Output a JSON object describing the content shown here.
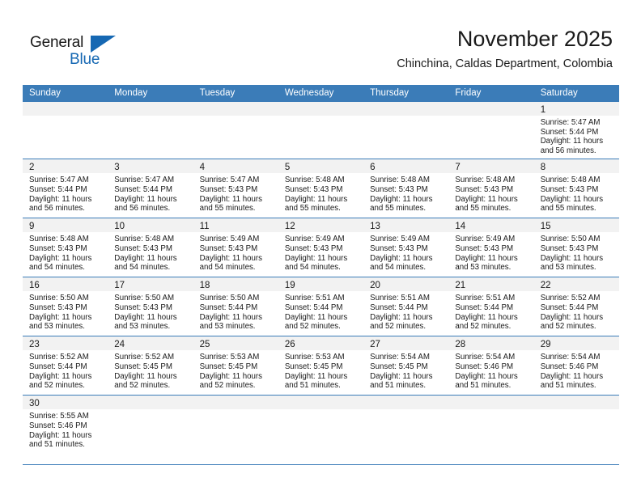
{
  "brand": {
    "name_part1": "General",
    "name_part2": "Blue",
    "accent_color": "#1668b3"
  },
  "header": {
    "title": "November 2025",
    "subtitle": "Chinchina, Caldas Department, Colombia"
  },
  "calendar": {
    "header_color": "#3b7cb8",
    "daynum_band_color": "#f2f2f2",
    "day_headers": [
      "Sunday",
      "Monday",
      "Tuesday",
      "Wednesday",
      "Thursday",
      "Friday",
      "Saturday"
    ],
    "labels": {
      "sunrise_prefix": "Sunrise:",
      "sunset_prefix": "Sunset:",
      "daylight_prefix": "Daylight:"
    },
    "weeks": [
      [
        {
          "empty": true
        },
        {
          "empty": true
        },
        {
          "empty": true
        },
        {
          "empty": true
        },
        {
          "empty": true
        },
        {
          "empty": true
        },
        {
          "day": "1",
          "sunrise": "Sunrise: 5:47 AM",
          "sunset": "Sunset: 5:44 PM",
          "daylight_line1": "Daylight: 11 hours",
          "daylight_line2": "and 56 minutes."
        }
      ],
      [
        {
          "day": "2",
          "sunrise": "Sunrise: 5:47 AM",
          "sunset": "Sunset: 5:44 PM",
          "daylight_line1": "Daylight: 11 hours",
          "daylight_line2": "and 56 minutes."
        },
        {
          "day": "3",
          "sunrise": "Sunrise: 5:47 AM",
          "sunset": "Sunset: 5:44 PM",
          "daylight_line1": "Daylight: 11 hours",
          "daylight_line2": "and 56 minutes."
        },
        {
          "day": "4",
          "sunrise": "Sunrise: 5:47 AM",
          "sunset": "Sunset: 5:43 PM",
          "daylight_line1": "Daylight: 11 hours",
          "daylight_line2": "and 55 minutes."
        },
        {
          "day": "5",
          "sunrise": "Sunrise: 5:48 AM",
          "sunset": "Sunset: 5:43 PM",
          "daylight_line1": "Daylight: 11 hours",
          "daylight_line2": "and 55 minutes."
        },
        {
          "day": "6",
          "sunrise": "Sunrise: 5:48 AM",
          "sunset": "Sunset: 5:43 PM",
          "daylight_line1": "Daylight: 11 hours",
          "daylight_line2": "and 55 minutes."
        },
        {
          "day": "7",
          "sunrise": "Sunrise: 5:48 AM",
          "sunset": "Sunset: 5:43 PM",
          "daylight_line1": "Daylight: 11 hours",
          "daylight_line2": "and 55 minutes."
        },
        {
          "day": "8",
          "sunrise": "Sunrise: 5:48 AM",
          "sunset": "Sunset: 5:43 PM",
          "daylight_line1": "Daylight: 11 hours",
          "daylight_line2": "and 55 minutes."
        }
      ],
      [
        {
          "day": "9",
          "sunrise": "Sunrise: 5:48 AM",
          "sunset": "Sunset: 5:43 PM",
          "daylight_line1": "Daylight: 11 hours",
          "daylight_line2": "and 54 minutes."
        },
        {
          "day": "10",
          "sunrise": "Sunrise: 5:48 AM",
          "sunset": "Sunset: 5:43 PM",
          "daylight_line1": "Daylight: 11 hours",
          "daylight_line2": "and 54 minutes."
        },
        {
          "day": "11",
          "sunrise": "Sunrise: 5:49 AM",
          "sunset": "Sunset: 5:43 PM",
          "daylight_line1": "Daylight: 11 hours",
          "daylight_line2": "and 54 minutes."
        },
        {
          "day": "12",
          "sunrise": "Sunrise: 5:49 AM",
          "sunset": "Sunset: 5:43 PM",
          "daylight_line1": "Daylight: 11 hours",
          "daylight_line2": "and 54 minutes."
        },
        {
          "day": "13",
          "sunrise": "Sunrise: 5:49 AM",
          "sunset": "Sunset: 5:43 PM",
          "daylight_line1": "Daylight: 11 hours",
          "daylight_line2": "and 54 minutes."
        },
        {
          "day": "14",
          "sunrise": "Sunrise: 5:49 AM",
          "sunset": "Sunset: 5:43 PM",
          "daylight_line1": "Daylight: 11 hours",
          "daylight_line2": "and 53 minutes."
        },
        {
          "day": "15",
          "sunrise": "Sunrise: 5:50 AM",
          "sunset": "Sunset: 5:43 PM",
          "daylight_line1": "Daylight: 11 hours",
          "daylight_line2": "and 53 minutes."
        }
      ],
      [
        {
          "day": "16",
          "sunrise": "Sunrise: 5:50 AM",
          "sunset": "Sunset: 5:43 PM",
          "daylight_line1": "Daylight: 11 hours",
          "daylight_line2": "and 53 minutes."
        },
        {
          "day": "17",
          "sunrise": "Sunrise: 5:50 AM",
          "sunset": "Sunset: 5:43 PM",
          "daylight_line1": "Daylight: 11 hours",
          "daylight_line2": "and 53 minutes."
        },
        {
          "day": "18",
          "sunrise": "Sunrise: 5:50 AM",
          "sunset": "Sunset: 5:44 PM",
          "daylight_line1": "Daylight: 11 hours",
          "daylight_line2": "and 53 minutes."
        },
        {
          "day": "19",
          "sunrise": "Sunrise: 5:51 AM",
          "sunset": "Sunset: 5:44 PM",
          "daylight_line1": "Daylight: 11 hours",
          "daylight_line2": "and 52 minutes."
        },
        {
          "day": "20",
          "sunrise": "Sunrise: 5:51 AM",
          "sunset": "Sunset: 5:44 PM",
          "daylight_line1": "Daylight: 11 hours",
          "daylight_line2": "and 52 minutes."
        },
        {
          "day": "21",
          "sunrise": "Sunrise: 5:51 AM",
          "sunset": "Sunset: 5:44 PM",
          "daylight_line1": "Daylight: 11 hours",
          "daylight_line2": "and 52 minutes."
        },
        {
          "day": "22",
          "sunrise": "Sunrise: 5:52 AM",
          "sunset": "Sunset: 5:44 PM",
          "daylight_line1": "Daylight: 11 hours",
          "daylight_line2": "and 52 minutes."
        }
      ],
      [
        {
          "day": "23",
          "sunrise": "Sunrise: 5:52 AM",
          "sunset": "Sunset: 5:44 PM",
          "daylight_line1": "Daylight: 11 hours",
          "daylight_line2": "and 52 minutes."
        },
        {
          "day": "24",
          "sunrise": "Sunrise: 5:52 AM",
          "sunset": "Sunset: 5:45 PM",
          "daylight_line1": "Daylight: 11 hours",
          "daylight_line2": "and 52 minutes."
        },
        {
          "day": "25",
          "sunrise": "Sunrise: 5:53 AM",
          "sunset": "Sunset: 5:45 PM",
          "daylight_line1": "Daylight: 11 hours",
          "daylight_line2": "and 52 minutes."
        },
        {
          "day": "26",
          "sunrise": "Sunrise: 5:53 AM",
          "sunset": "Sunset: 5:45 PM",
          "daylight_line1": "Daylight: 11 hours",
          "daylight_line2": "and 51 minutes."
        },
        {
          "day": "27",
          "sunrise": "Sunrise: 5:54 AM",
          "sunset": "Sunset: 5:45 PM",
          "daylight_line1": "Daylight: 11 hours",
          "daylight_line2": "and 51 minutes."
        },
        {
          "day": "28",
          "sunrise": "Sunrise: 5:54 AM",
          "sunset": "Sunset: 5:46 PM",
          "daylight_line1": "Daylight: 11 hours",
          "daylight_line2": "and 51 minutes."
        },
        {
          "day": "29",
          "sunrise": "Sunrise: 5:54 AM",
          "sunset": "Sunset: 5:46 PM",
          "daylight_line1": "Daylight: 11 hours",
          "daylight_line2": "and 51 minutes."
        }
      ],
      [
        {
          "day": "30",
          "sunrise": "Sunrise: 5:55 AM",
          "sunset": "Sunset: 5:46 PM",
          "daylight_line1": "Daylight: 11 hours",
          "daylight_line2": "and 51 minutes."
        },
        {
          "empty": true
        },
        {
          "empty": true
        },
        {
          "empty": true
        },
        {
          "empty": true
        },
        {
          "empty": true
        },
        {
          "empty": true
        }
      ]
    ]
  }
}
